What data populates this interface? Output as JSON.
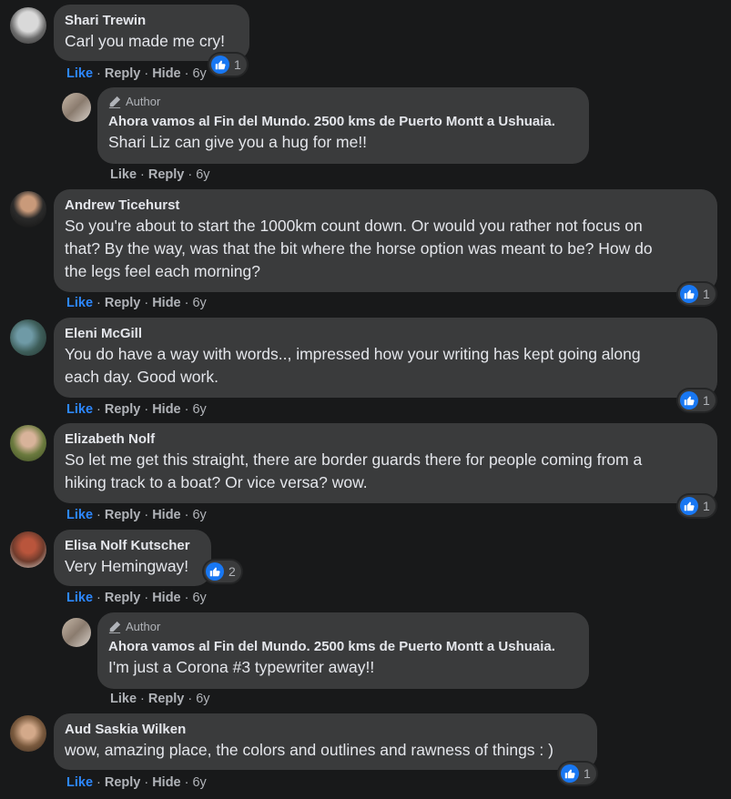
{
  "actions": {
    "like": "Like",
    "reply": "Reply",
    "hide": "Hide",
    "sep": "·"
  },
  "author_badge": "Author",
  "comments": [
    {
      "name": "Shari Trewin",
      "text": "Carl you made me cry!",
      "time": "6y",
      "reactions": "1"
    },
    {
      "name": "Ahora vamos al Fin del Mundo. 2500 kms de Puerto Montt a Ushuaia.",
      "text": "Shari Liz can give you a hug for me!!",
      "time": "6y"
    },
    {
      "name": "Andrew Ticehurst",
      "lines": [
        "So you're about to start the 1000km count down. Or would you rather not focus on",
        "that? By the way, was that the bit where the horse option was meant to be? How do",
        "the legs feel each morning?"
      ],
      "time": "6y",
      "reactions": "1"
    },
    {
      "name": "Eleni McGill",
      "lines": [
        "You do have a way with words.., impressed how your writing has kept going along",
        "each day. Good work."
      ],
      "time": "6y",
      "reactions": "1"
    },
    {
      "name": "Elizabeth Nolf",
      "lines": [
        "So let me get this straight, there are border guards there for people coming from a",
        "hiking track to a boat? Or vice versa? wow."
      ],
      "time": "6y",
      "reactions": "1"
    },
    {
      "name": "Elisa Nolf Kutscher",
      "text": "Very Hemingway!",
      "time": "6y",
      "reactions": "2"
    },
    {
      "name": "Ahora vamos al Fin del Mundo. 2500 kms de Puerto Montt a Ushuaia.",
      "text": "I'm just a Corona #3 typewriter away!!",
      "time": "6y"
    },
    {
      "name": "Aud Saskia Wilken",
      "text": "wow, amazing place, the colors and outlines and rawness of things : )",
      "time": "6y",
      "reactions": "1"
    }
  ],
  "colors": {
    "background": "#18191a",
    "bubble": "#3a3b3c",
    "like_blue": "#2d88ff",
    "muted": "#b0b3b8"
  }
}
